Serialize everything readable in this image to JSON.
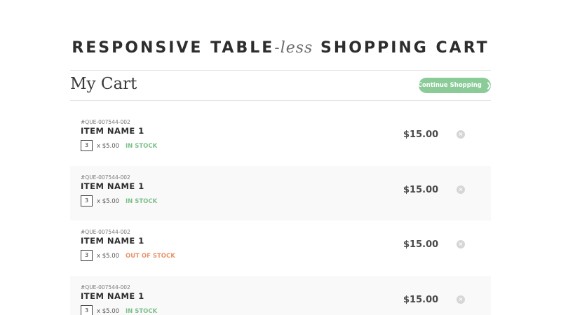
{
  "page": {
    "title_part1": "RESPONSIVE TABLE",
    "title_part2": "-less",
    "title_part3": " SHOPPING CART"
  },
  "cart": {
    "heading": "My Cart",
    "continue_label": "Continue Shopping",
    "continue_icon": "chevron-right-icon"
  },
  "items": [
    {
      "sku": "#QUE-007544-002",
      "name": "ITEM NAME 1",
      "qty": "3",
      "unit": "x $5.00",
      "stock": "IN STOCK",
      "stock_status": "in",
      "price": "$15.00"
    },
    {
      "sku": "#QUE-007544-002",
      "name": "ITEM NAME 1",
      "qty": "3",
      "unit": "x $5.00",
      "stock": "IN STOCK",
      "stock_status": "in",
      "price": "$15.00"
    },
    {
      "sku": "#QUE-007544-002",
      "name": "ITEM NAME 1",
      "qty": "3",
      "unit": "x $5.00",
      "stock": "OUT OF STOCK",
      "stock_status": "out",
      "price": "$15.00"
    },
    {
      "sku": "#QUE-007544-002",
      "name": "ITEM NAME 1",
      "qty": "3",
      "unit": "x $5.00",
      "stock": "IN STOCK",
      "stock_status": "in",
      "price": "$15.00"
    }
  ],
  "colors": {
    "accent": "#8acb98",
    "in_stock": "#7cc08a",
    "out_of_stock": "#e8946a",
    "row_alt": "#f9f9f9"
  }
}
